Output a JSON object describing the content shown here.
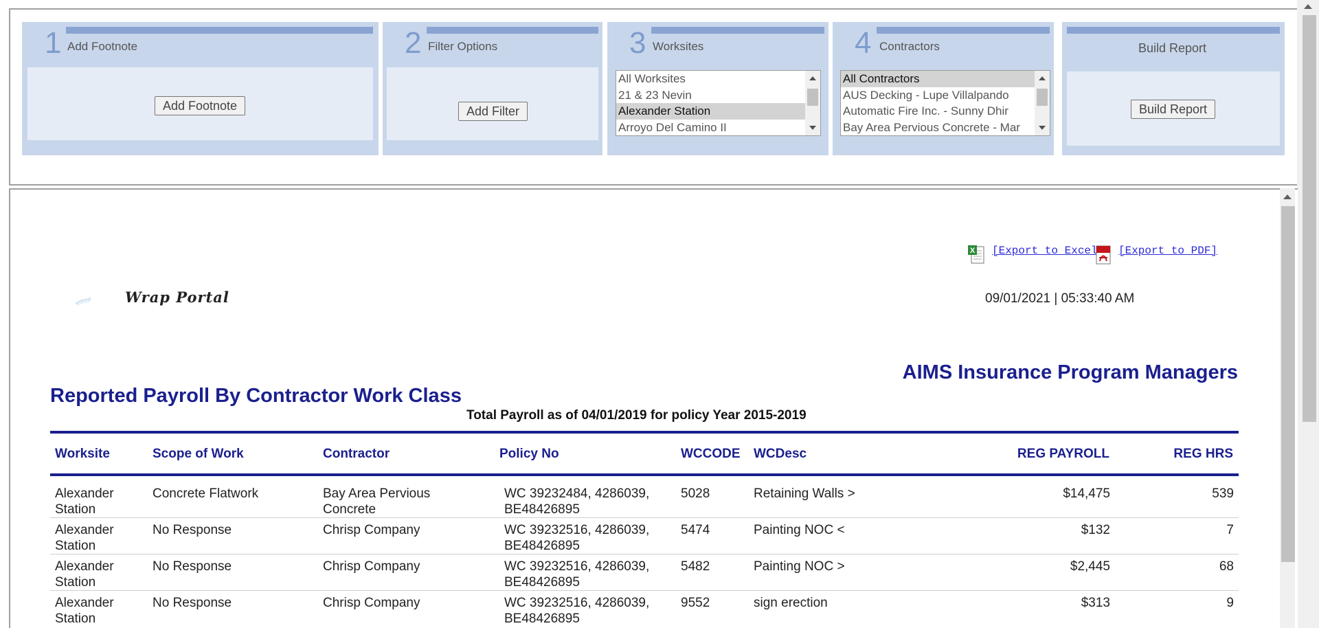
{
  "steps": [
    {
      "num": "1",
      "title": "Add Footnote",
      "button": "Add Footnote"
    },
    {
      "num": "2",
      "title": "Filter Options",
      "button": "Add Filter"
    },
    {
      "num": "3",
      "title": "Worksites"
    },
    {
      "num": "4",
      "title": "Contractors"
    },
    {
      "title": "Build Report",
      "button": "Build Report"
    }
  ],
  "worksites": [
    "All Worksites",
    "21 & 23 Nevin",
    "Alexander Station",
    "Arroyo Del Camino II"
  ],
  "worksites_selected": "Alexander Station",
  "contractors": [
    "All Contractors",
    "AUS Decking - Lupe Villalpando",
    "Automatic Fire Inc. - Sunny Dhir",
    "Bay Area Pervious Concrete - Mar"
  ],
  "contractors_selected": "All Contractors",
  "export": {
    "excel": "[Export to Excel]",
    "pdf": "[Export to PDF]"
  },
  "logo_text": "Wrap Portal",
  "timestamp": "09/01/2021 | 05:33:40 AM",
  "company": "AIMS Insurance Program Managers",
  "report_title": "Reported Payroll By Contractor Work Class",
  "subtitle": "Total Payroll as of 04/01/2019 for policy Year 2015-2019",
  "columns": [
    "Worksite",
    "Scope of Work",
    "Contractor",
    "Policy No",
    "WCCODE",
    "WCDesc",
    "REG PAYROLL",
    "REG HRS"
  ],
  "rows": [
    {
      "worksite": [
        "Alexander",
        "Station"
      ],
      "scope": "Concrete Flatwork",
      "contractor": [
        "Bay Area Pervious",
        "Concrete"
      ],
      "policy": [
        "WC 39232484, 4286039,",
        "BE48426895"
      ],
      "wccode": "5028",
      "wcdesc": "Retaining Walls >",
      "payroll": "$14,475",
      "hrs": "539"
    },
    {
      "worksite": [
        "Alexander",
        "Station"
      ],
      "scope": "No Response",
      "contractor": [
        "Chrisp Company",
        ""
      ],
      "policy": [
        "WC 39232516, 4286039,",
        "BE48426895"
      ],
      "wccode": "5474",
      "wcdesc": "Painting NOC <",
      "payroll": "$132",
      "hrs": "7"
    },
    {
      "worksite": [
        "Alexander",
        "Station"
      ],
      "scope": "No Response",
      "contractor": [
        "Chrisp Company",
        ""
      ],
      "policy": [
        "WC 39232516, 4286039,",
        "BE48426895"
      ],
      "wccode": "5482",
      "wcdesc": "Painting NOC >",
      "payroll": "$2,445",
      "hrs": "68"
    },
    {
      "worksite": [
        "Alexander",
        "Station"
      ],
      "scope": "No Response",
      "contractor": [
        "Chrisp Company",
        ""
      ],
      "policy": [
        "WC 39232516, 4286039,",
        "BE48426895"
      ],
      "wccode": "9552",
      "wcdesc": "sign erection",
      "payroll": "$313",
      "hrs": "9"
    }
  ]
}
